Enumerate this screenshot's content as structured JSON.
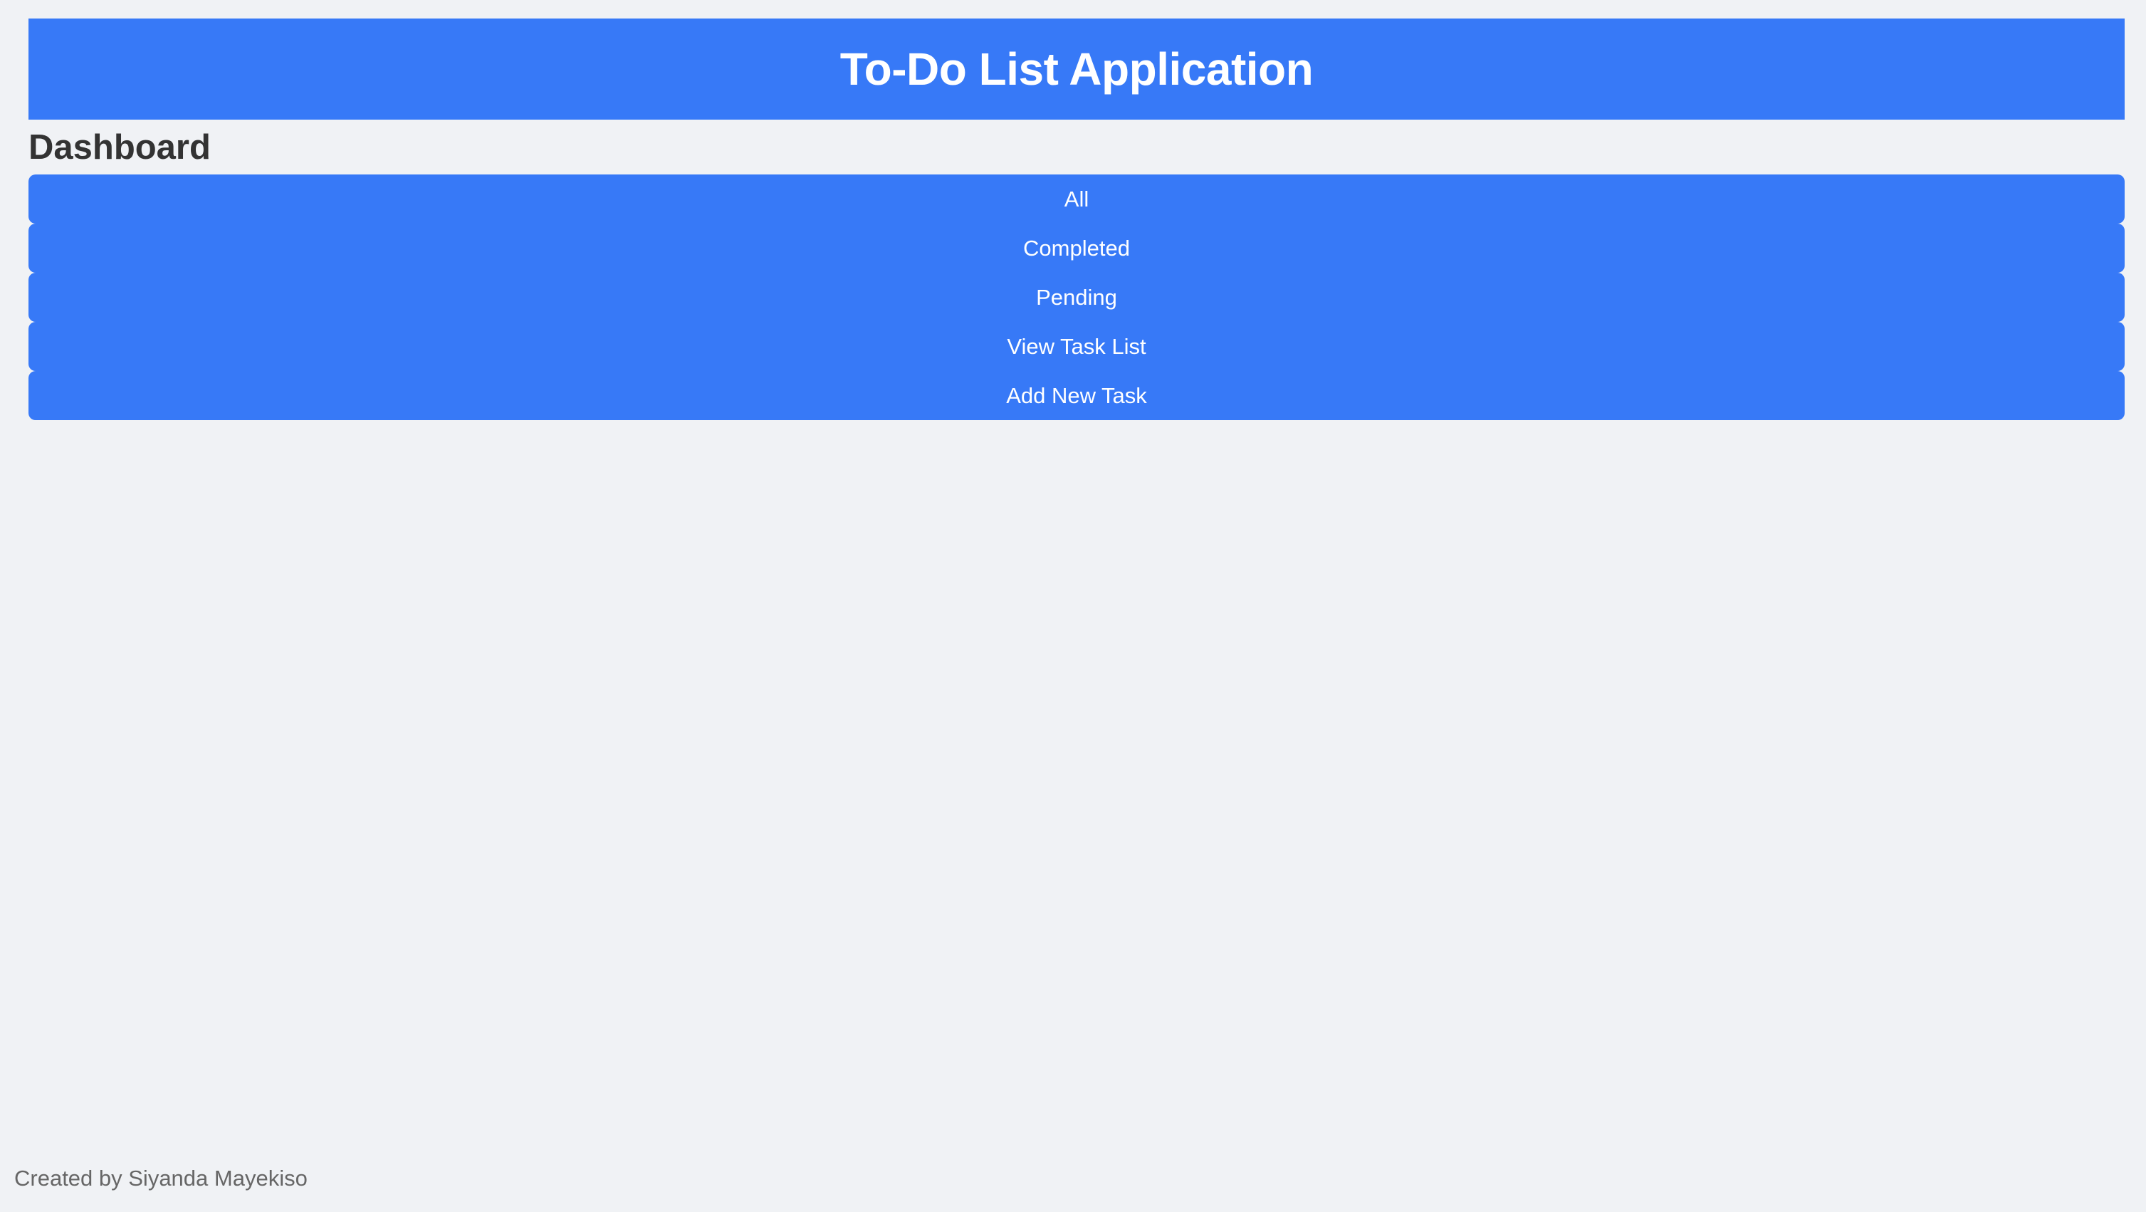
{
  "header": {
    "title": "To-Do List Application"
  },
  "dashboard": {
    "title": "Dashboard",
    "buttons": [
      {
        "label": "All"
      },
      {
        "label": "Completed"
      },
      {
        "label": "Pending"
      },
      {
        "label": "View Task List"
      },
      {
        "label": "Add New Task"
      }
    ]
  },
  "footer": {
    "text": "Created by Siyanda Mayekiso"
  },
  "colors": {
    "primary": "#3779f7",
    "background": "#f0f2f5",
    "heading_text": "#333333",
    "footer_text": "#666666"
  }
}
